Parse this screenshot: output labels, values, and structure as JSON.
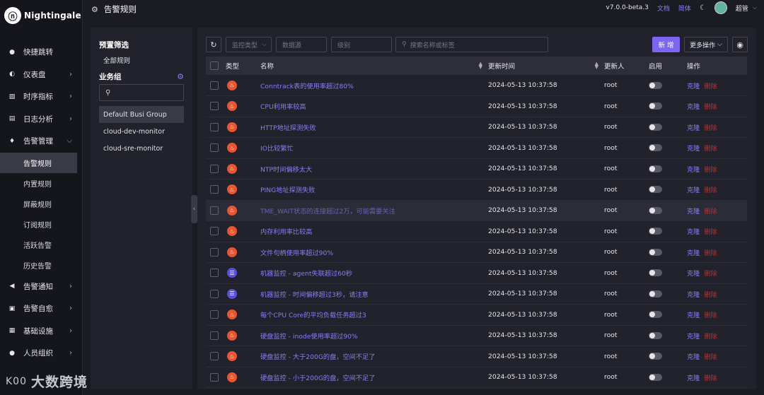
{
  "app": {
    "logo_glyph": "ⓝ",
    "name": "Nightingale"
  },
  "topbar": {
    "page_title": "告警规则",
    "version": "v7.0.0-beta.3",
    "docs": "文档",
    "language": "简体",
    "user": "超管"
  },
  "sidebar": {
    "items": [
      {
        "label": "快捷跳转",
        "icon": "search-icon",
        "glyph": "●"
      },
      {
        "label": "仪表盘",
        "icon": "dashboard-icon",
        "glyph": "◐"
      },
      {
        "label": "时序指标",
        "icon": "metrics-icon",
        "glyph": "▨"
      },
      {
        "label": "日志分析",
        "icon": "log-icon",
        "glyph": "▤"
      },
      {
        "label": "告警管理",
        "icon": "alert-icon",
        "glyph": "♦"
      }
    ],
    "sub_items": [
      {
        "label": "告警规则",
        "active": true
      },
      {
        "label": "内置规则"
      },
      {
        "label": "屏蔽规则"
      },
      {
        "label": "订阅规则"
      },
      {
        "label": "活跃告警"
      },
      {
        "label": "历史告警"
      }
    ],
    "bottom_items": [
      {
        "label": "告警通知",
        "icon": "megaphone-icon",
        "glyph": "◀"
      },
      {
        "label": "告警自愈",
        "icon": "selfheal-icon",
        "glyph": "▣"
      },
      {
        "label": "基础设施",
        "icon": "server-icon",
        "glyph": "▦"
      },
      {
        "label": "人员组织",
        "icon": "user-icon",
        "glyph": "●"
      }
    ]
  },
  "left_panel": {
    "preset_title": "预置筛选",
    "all_rules": "全部规则",
    "group_title": "业务组",
    "groups": [
      "Default Busi Group",
      "cloud-dev-monitor",
      "cloud-sre-monitor"
    ]
  },
  "toolbar": {
    "monitor_type_placeholder": "监控类型",
    "datasource_placeholder": "数据源",
    "severity_placeholder": "级别",
    "search_placeholder": "搜索名称或标签",
    "new_label": "新 增",
    "more_label": "更多操作"
  },
  "table": {
    "headers": {
      "type": "类型",
      "name": "名称",
      "updated_at": "更新时间",
      "updated_by": "更新人",
      "enabled": "启用",
      "ops": "操作"
    },
    "clone_label": "克隆",
    "delete_label": "删除",
    "rows": [
      {
        "type": "prometheus",
        "name": "Conntrack表的使用率超过80%",
        "time": "2024-05-13 10:37:58",
        "by": "root"
      },
      {
        "type": "prometheus",
        "name": "CPU利用率较高",
        "time": "2024-05-13 10:37:58",
        "by": "root"
      },
      {
        "type": "prometheus",
        "name": "HTTP地址探测失败",
        "time": "2024-05-13 10:37:58",
        "by": "root"
      },
      {
        "type": "prometheus",
        "name": "IO比较繁忙",
        "time": "2024-05-13 10:37:58",
        "by": "root"
      },
      {
        "type": "prometheus",
        "name": "NTP时间偏移太大",
        "time": "2024-05-13 10:37:58",
        "by": "root"
      },
      {
        "type": "prometheus",
        "name": "PING地址探测失败",
        "time": "2024-05-13 10:37:58",
        "by": "root"
      },
      {
        "type": "prometheus",
        "name": "TME_WAIT状态的连接超过2万，可能需要关注",
        "time": "2024-05-13 10:37:58",
        "by": "root",
        "highlight": true
      },
      {
        "type": "prometheus",
        "name": "内存利用率比较高",
        "time": "2024-05-13 10:37:58",
        "by": "root"
      },
      {
        "type": "prometheus",
        "name": "文件句柄使用率超过90%",
        "time": "2024-05-13 10:37:58",
        "by": "root"
      },
      {
        "type": "host",
        "name": "机器监控 - agent失联超过60秒",
        "time": "2024-05-13 10:37:58",
        "by": "root"
      },
      {
        "type": "host",
        "name": "机器监控 - 时间偏移超过3秒，请注意",
        "time": "2024-05-13 10:37:58",
        "by": "root"
      },
      {
        "type": "prometheus",
        "name": "每个CPU Core的平均负载任务超过3",
        "time": "2024-05-13 10:37:58",
        "by": "root"
      },
      {
        "type": "prometheus",
        "name": "硬盘监控 - inode使用率超过90%",
        "time": "2024-05-13 10:37:58",
        "by": "root"
      },
      {
        "type": "prometheus",
        "name": "硬盘监控 - 大于200G的盘，空间不足了",
        "time": "2024-05-13 10:37:58",
        "by": "root"
      },
      {
        "type": "prometheus",
        "name": "硬盘监控 - 小于200G的盘，空间不足了",
        "time": "2024-05-13 10:37:58",
        "by": "root"
      }
    ]
  },
  "watermark": {
    "mark": "K00",
    "text": "大数跨境"
  }
}
